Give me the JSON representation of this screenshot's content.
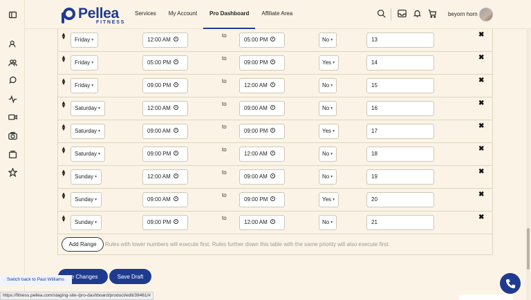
{
  "header": {
    "logo_name": "Pellea",
    "logo_sub": "FITNESS",
    "nav": [
      {
        "label": "Services"
      },
      {
        "label": "My Account"
      },
      {
        "label": "Pro Dashboard"
      },
      {
        "label": "Affiliate Area"
      }
    ],
    "user_name": "beyorn horn"
  },
  "labels": {
    "to": "to",
    "add_range": "Add Range",
    "note": "Rules with lower numbers will execute first. Rules further down this table with the same priority will also execute first.",
    "save_changes": "ve Changes",
    "save_draft": "Save Draft",
    "switch_back": "Switch back to Paul Williams",
    "status_url": "https://fitness.pellea.com/staging-site-/pro-dashboard/product/edit/39461/#"
  },
  "rows": [
    {
      "day": "Friday",
      "from": "12:00 AM",
      "to": "05:00 PM",
      "flag": "No",
      "priority": "13"
    },
    {
      "day": "Friday",
      "from": "05:00 PM",
      "to": "09:00 PM",
      "flag": "Yes",
      "priority": "14"
    },
    {
      "day": "Friday",
      "from": "09:00 PM",
      "to": "12:00 AM",
      "flag": "No",
      "priority": "15"
    },
    {
      "day": "Saturday",
      "from": "12:00 AM",
      "to": "09:00 AM",
      "flag": "No",
      "priority": "16"
    },
    {
      "day": "Saturday",
      "from": "09:00 AM",
      "to": "09:00 PM",
      "flag": "Yes",
      "priority": "17"
    },
    {
      "day": "Saturday",
      "from": "09:00 PM",
      "to": "12:00 AM",
      "flag": "No",
      "priority": "18"
    },
    {
      "day": "Sunday",
      "from": "12:00 AM",
      "to": "09:00 AM",
      "flag": "No",
      "priority": "19"
    },
    {
      "day": "Sunday",
      "from": "09:00 AM",
      "to": "09:00 PM",
      "flag": "Yes",
      "priority": "20"
    },
    {
      "day": "Sunday",
      "from": "09:00 PM",
      "to": "12:00 AM",
      "flag": "No",
      "priority": "21"
    }
  ]
}
